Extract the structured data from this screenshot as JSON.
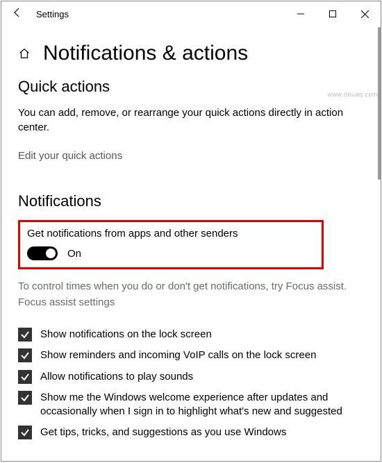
{
  "window": {
    "title": "Settings"
  },
  "page": {
    "title": "Notifications & actions"
  },
  "quick_actions": {
    "heading": "Quick actions",
    "description": "You can add, remove, or rearrange your quick actions directly in action center.",
    "edit_link": "Edit your quick actions"
  },
  "notifications": {
    "heading": "Notifications",
    "master_toggle": {
      "label": "Get notifications from apps and other senders",
      "state_text": "On",
      "on": true
    },
    "focus_assist_help": "To control times when you do or don't get notifications, try Focus assist.",
    "focus_assist_link": "Focus assist settings",
    "options": [
      {
        "label": "Show notifications on the lock screen",
        "checked": true
      },
      {
        "label": "Show reminders and incoming VoIP calls on the lock screen",
        "checked": true
      },
      {
        "label": "Allow notifications to play sounds",
        "checked": true
      },
      {
        "label": "Show me the Windows welcome experience after updates and occasionally when I sign in to highlight what's new and suggested",
        "checked": true
      },
      {
        "label": "Get tips, tricks, and suggestions as you use Windows",
        "checked": true
      }
    ]
  },
  "watermark": "www.deuaq.com"
}
